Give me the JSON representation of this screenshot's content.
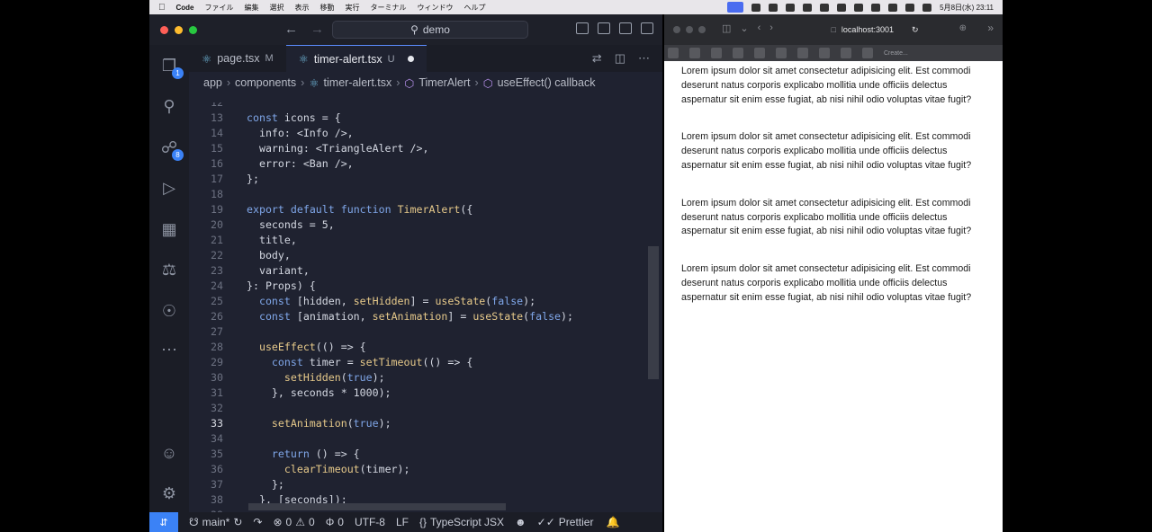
{
  "menubar": {
    "app": "Code",
    "menus": [
      "ファイル",
      "編集",
      "選択",
      "表示",
      "移動",
      "実行",
      "ターミナル",
      "ウィンドウ",
      "ヘルプ"
    ],
    "clock": "5月8日(水) 23:11"
  },
  "vscode": {
    "search_label": "demo",
    "activity_badges": {
      "explorer": "1",
      "source_control": "8"
    },
    "tabs": [
      {
        "label": "page.tsx",
        "status": "M"
      },
      {
        "label": "timer-alert.tsx",
        "status": "U"
      }
    ],
    "breadcrumb": [
      "app",
      "components",
      "timer-alert.tsx",
      "TimerAlert",
      "useEffect() callback"
    ],
    "lines": [
      {
        "n": "12",
        "text": ""
      },
      {
        "n": "13",
        "text": "const icons = {"
      },
      {
        "n": "14",
        "text": "  info: <Info />,"
      },
      {
        "n": "15",
        "text": "  warning: <TriangleAlert />,"
      },
      {
        "n": "16",
        "text": "  error: <Ban />,"
      },
      {
        "n": "17",
        "text": "};"
      },
      {
        "n": "18",
        "text": ""
      },
      {
        "n": "19",
        "text": "export default function TimerAlert({"
      },
      {
        "n": "20",
        "text": "  seconds = 5,"
      },
      {
        "n": "21",
        "text": "  title,"
      },
      {
        "n": "22",
        "text": "  body,"
      },
      {
        "n": "23",
        "text": "  variant,"
      },
      {
        "n": "24",
        "text": "}: Props) {"
      },
      {
        "n": "25",
        "text": "  const [hidden, setHidden] = useState(false);"
      },
      {
        "n": "26",
        "text": "  const [animation, setAnimation] = useState(false);"
      },
      {
        "n": "27",
        "text": ""
      },
      {
        "n": "28",
        "text": "  useEffect(() => {"
      },
      {
        "n": "29",
        "text": "    const timer = setTimeout(() => {"
      },
      {
        "n": "30",
        "text": "      setHidden(true);"
      },
      {
        "n": "31",
        "text": "    }, seconds * 1000);"
      },
      {
        "n": "32",
        "text": ""
      },
      {
        "n": "33",
        "text": "    setAnimation(true);"
      },
      {
        "n": "34",
        "text": ""
      },
      {
        "n": "35",
        "text": "    return () => {"
      },
      {
        "n": "36",
        "text": "      clearTimeout(timer);"
      },
      {
        "n": "37",
        "text": "    };"
      },
      {
        "n": "38",
        "text": "  }, [seconds]);"
      },
      {
        "n": "39",
        "text": ""
      }
    ],
    "current_line": "33",
    "status": {
      "branch": "main*",
      "errors": "0",
      "warnings": "0",
      "ports": "0",
      "encoding": "UTF-8",
      "eol": "LF",
      "language": "TypeScript JSX",
      "formatter": "Prettier"
    }
  },
  "browser": {
    "url": "localhost:3001",
    "fav_label": "Create...",
    "paragraphs": [
      "Lorem ipsum dolor sit amet consectetur adipisicing elit. Est commodi deserunt natus corporis explicabo mollitia unde officiis delectus aspernatur sit enim esse fugiat, ab nisi nihil odio voluptas vitae fugit?",
      "Lorem ipsum dolor sit amet consectetur adipisicing elit. Est commodi deserunt natus corporis explicabo mollitia unde officiis delectus aspernatur sit enim esse fugiat, ab nisi nihil odio voluptas vitae fugit?",
      "Lorem ipsum dolor sit amet consectetur adipisicing elit. Est commodi deserunt natus corporis explicabo mollitia unde officiis delectus aspernatur sit enim esse fugiat, ab nisi nihil odio voluptas vitae fugit?",
      "Lorem ipsum dolor sit amet consectetur adipisicing elit. Est commodi deserunt natus corporis explicabo mollitia unde officiis delectus aspernatur sit enim esse fugiat, ab nisi nihil odio voluptas vitae fugit?"
    ]
  },
  "colors": {
    "editor_bg": "#1f2230",
    "accent": "#3b82f6",
    "keyword": "#7fa6e8",
    "function": "#e6c98a"
  }
}
